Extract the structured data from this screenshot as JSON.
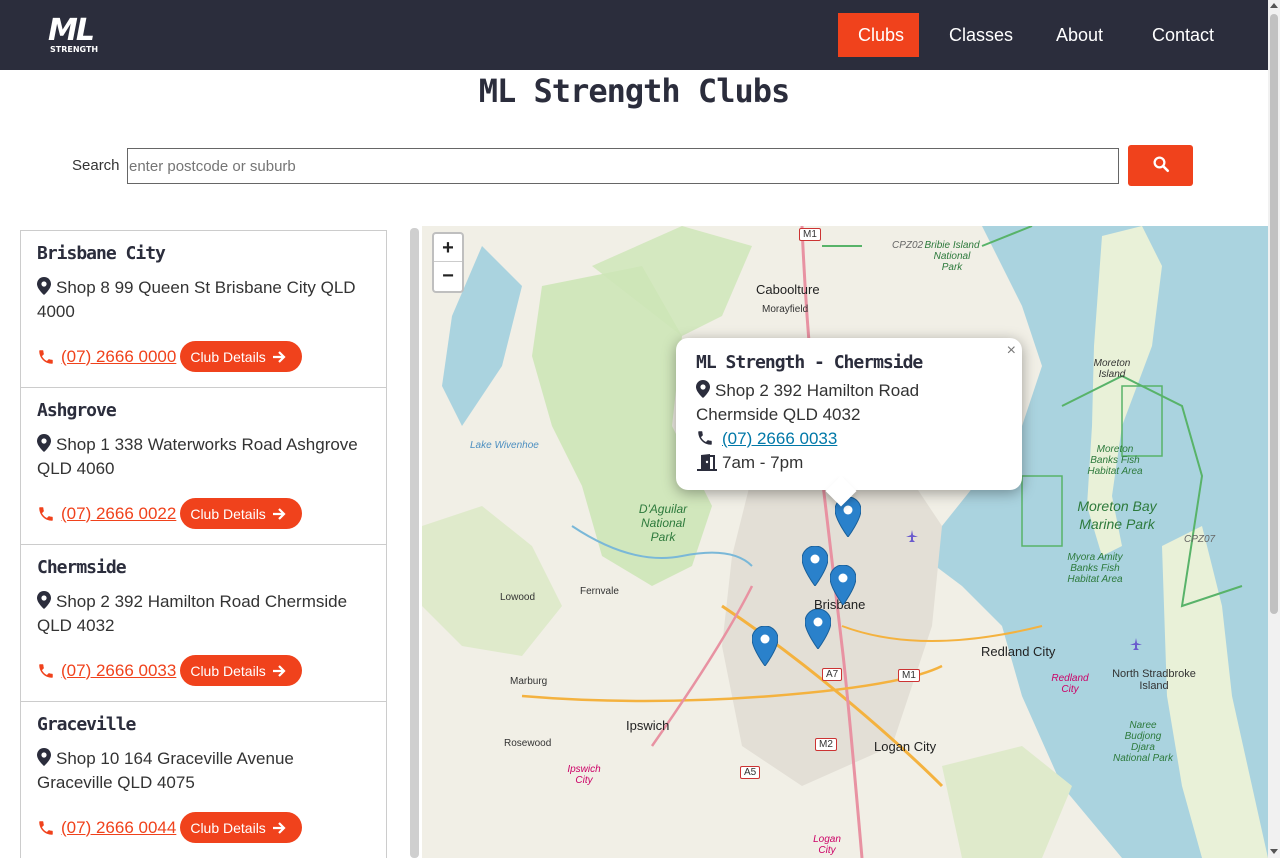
{
  "nav": {
    "logo_main": "ML",
    "logo_sub": "STRENGTH",
    "items": [
      {
        "label": "Clubs",
        "active": true
      },
      {
        "label": "Classes",
        "active": false
      },
      {
        "label": "About",
        "active": false
      },
      {
        "label": "Contact",
        "active": false
      }
    ]
  },
  "page_title": "ML Strength Clubs",
  "search": {
    "label": "Search",
    "placeholder": "enter postcode or suburb",
    "button_icon": "search-icon"
  },
  "clubs": [
    {
      "name": "Brisbane City",
      "address": "Shop 8 99 Queen St Brisbane City QLD 4000",
      "phone": "(07) 2666 0000",
      "button": "Club Details"
    },
    {
      "name": "Ashgrove",
      "address": "Shop 1 338 Waterworks Road Ashgrove QLD 4060",
      "phone": "(07) 2666 0022",
      "button": "Club Details"
    },
    {
      "name": "Chermside",
      "address": "Shop 2 392 Hamilton Road Chermside QLD 4032",
      "phone": "(07) 2666 0033",
      "button": "Club Details"
    },
    {
      "name": "Graceville",
      "address": "Shop 10 164 Graceville Avenue Graceville QLD 4075",
      "phone": "(07) 2666 0044",
      "button": "Club Details"
    }
  ],
  "map": {
    "zoom_in": "+",
    "zoom_out": "−",
    "popup": {
      "close": "×",
      "title": "ML Strength - Chermside",
      "address_line1": "Shop 2 392 Hamilton Road",
      "address_line2": "Chermside QLD 4032",
      "phone": "(07) 2666 0033",
      "hours": "7am - 7pm"
    },
    "labels": {
      "caboolture": "Caboolture",
      "morayfield": "Morayfield",
      "bribie": "Bribie Island National Park",
      "moreton_island": "Moreton Island",
      "moreton_banks": "Moreton Banks Fish Habitat Area",
      "moreton_bay": "Moreton Bay Marine Park",
      "myora": "Myora Amity Banks Fish Habitat Area",
      "lake_wivenhoe": "Lake Wivenhoe",
      "daguilar": "D'Aguilar National Park",
      "lowood": "Lowood",
      "fernvale": "Fernvale",
      "brisbane": "Brisbane",
      "redland_city": "Redland City",
      "redland_city_small": "Redland City",
      "north_stradbroke": "North Stradbroke Island",
      "marburg": "Marburg",
      "ipswich": "Ipswich",
      "rosewood": "Rosewood",
      "ipswich_city": "Ipswich City",
      "logan_city": "Logan City",
      "logan_city_small": "Logan City",
      "naree": "Naree Budjong Djara National Park",
      "cpz02": "CPZ02",
      "cpz07": "CPZ07"
    },
    "shields": [
      "M1",
      "A7",
      "M1",
      "M2",
      "A5"
    ]
  }
}
